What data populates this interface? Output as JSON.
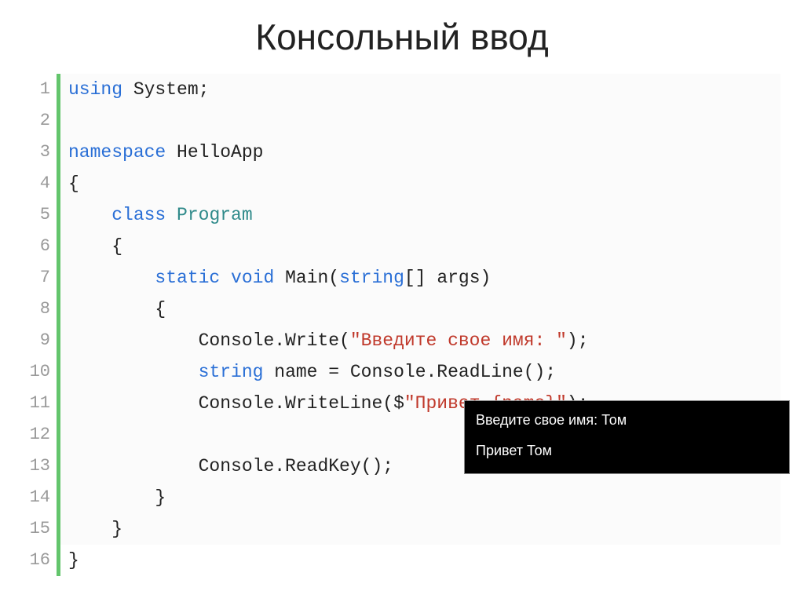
{
  "title": "Консольный ввод",
  "code_lines": [
    {
      "n": 1,
      "tokens": [
        {
          "t": "using ",
          "c": "kw"
        },
        {
          "t": "System;",
          "c": "ident"
        }
      ]
    },
    {
      "n": 2,
      "tokens": [
        {
          "t": "",
          "c": "ident"
        }
      ]
    },
    {
      "n": 3,
      "tokens": [
        {
          "t": "namespace ",
          "c": "kw"
        },
        {
          "t": "HelloApp",
          "c": "ident"
        }
      ]
    },
    {
      "n": 4,
      "tokens": [
        {
          "t": "{",
          "c": "pun"
        }
      ]
    },
    {
      "n": 5,
      "tokens": [
        {
          "t": "    ",
          "c": "pun"
        },
        {
          "t": "class ",
          "c": "kw"
        },
        {
          "t": "Program",
          "c": "cls"
        }
      ]
    },
    {
      "n": 6,
      "tokens": [
        {
          "t": "    {",
          "c": "pun"
        }
      ]
    },
    {
      "n": 7,
      "tokens": [
        {
          "t": "        ",
          "c": "pun"
        },
        {
          "t": "static void ",
          "c": "kw"
        },
        {
          "t": "Main(",
          "c": "ident"
        },
        {
          "t": "string",
          "c": "kw"
        },
        {
          "t": "[] args)",
          "c": "ident"
        }
      ]
    },
    {
      "n": 8,
      "tokens": [
        {
          "t": "        {",
          "c": "pun"
        }
      ]
    },
    {
      "n": 9,
      "tokens": [
        {
          "t": "            Console.Write(",
          "c": "ident"
        },
        {
          "t": "\"Введите свое имя: \"",
          "c": "str"
        },
        {
          "t": ");",
          "c": "pun"
        }
      ]
    },
    {
      "n": 10,
      "tokens": [
        {
          "t": "            ",
          "c": "pun"
        },
        {
          "t": "string ",
          "c": "kw"
        },
        {
          "t": "name = Console.ReadLine();",
          "c": "ident"
        }
      ]
    },
    {
      "n": 11,
      "tokens": [
        {
          "t": "            Console.WriteLine($",
          "c": "ident"
        },
        {
          "t": "\"Привет {name}\"",
          "c": "str"
        },
        {
          "t": ");",
          "c": "pun"
        }
      ]
    },
    {
      "n": 12,
      "tokens": [
        {
          "t": "",
          "c": "ident"
        }
      ]
    },
    {
      "n": 13,
      "tokens": [
        {
          "t": "            Console.ReadKey();",
          "c": "ident"
        }
      ]
    },
    {
      "n": 14,
      "tokens": [
        {
          "t": "        }",
          "c": "pun"
        }
      ]
    },
    {
      "n": 15,
      "tokens": [
        {
          "t": "    }",
          "c": "pun"
        }
      ]
    },
    {
      "n": 16,
      "tokens": [
        {
          "t": "}",
          "c": "pun"
        }
      ],
      "last": true
    }
  ],
  "console": {
    "line1": "Введите свое имя: Том",
    "line2": "Привет Том"
  }
}
